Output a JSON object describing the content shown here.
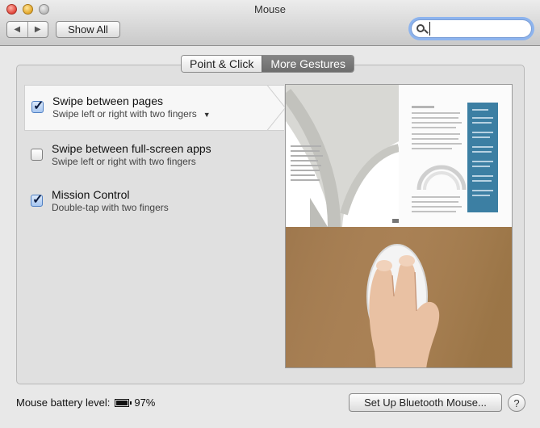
{
  "window": {
    "title": "Mouse"
  },
  "toolbar": {
    "back_glyph": "◀",
    "forward_glyph": "▶",
    "show_all_label": "Show All",
    "search_value": "",
    "search_placeholder": ""
  },
  "tabs": [
    {
      "label": "Point & Click",
      "active": false
    },
    {
      "label": "More Gestures",
      "active": true
    }
  ],
  "options": [
    {
      "label": "Swipe between pages",
      "sub": "Swipe left or right with two fingers",
      "checked": true,
      "has_dropdown": true,
      "dropdown_glyph": "▼"
    },
    {
      "label": "Swipe between full-screen apps",
      "sub": "Swipe left or right with two fingers",
      "checked": false
    },
    {
      "label": "Mission Control",
      "sub": "Double-tap with two fingers",
      "checked": true
    }
  ],
  "check_glyph": "✓",
  "footer": {
    "battery_label": "Mouse battery level:",
    "battery_value": "97%",
    "battery_level": 0.97,
    "bluetooth_button": "Set Up Bluetooth Mouse...",
    "help_glyph": "?"
  },
  "colors": {
    "accent_focus": "#8db4ee",
    "checkbox_checked": "#a7c6f0",
    "tab_active": "#6d6d6d",
    "sidebar_blue": "#3c7fa3",
    "desk_wood": "#a57d52"
  }
}
